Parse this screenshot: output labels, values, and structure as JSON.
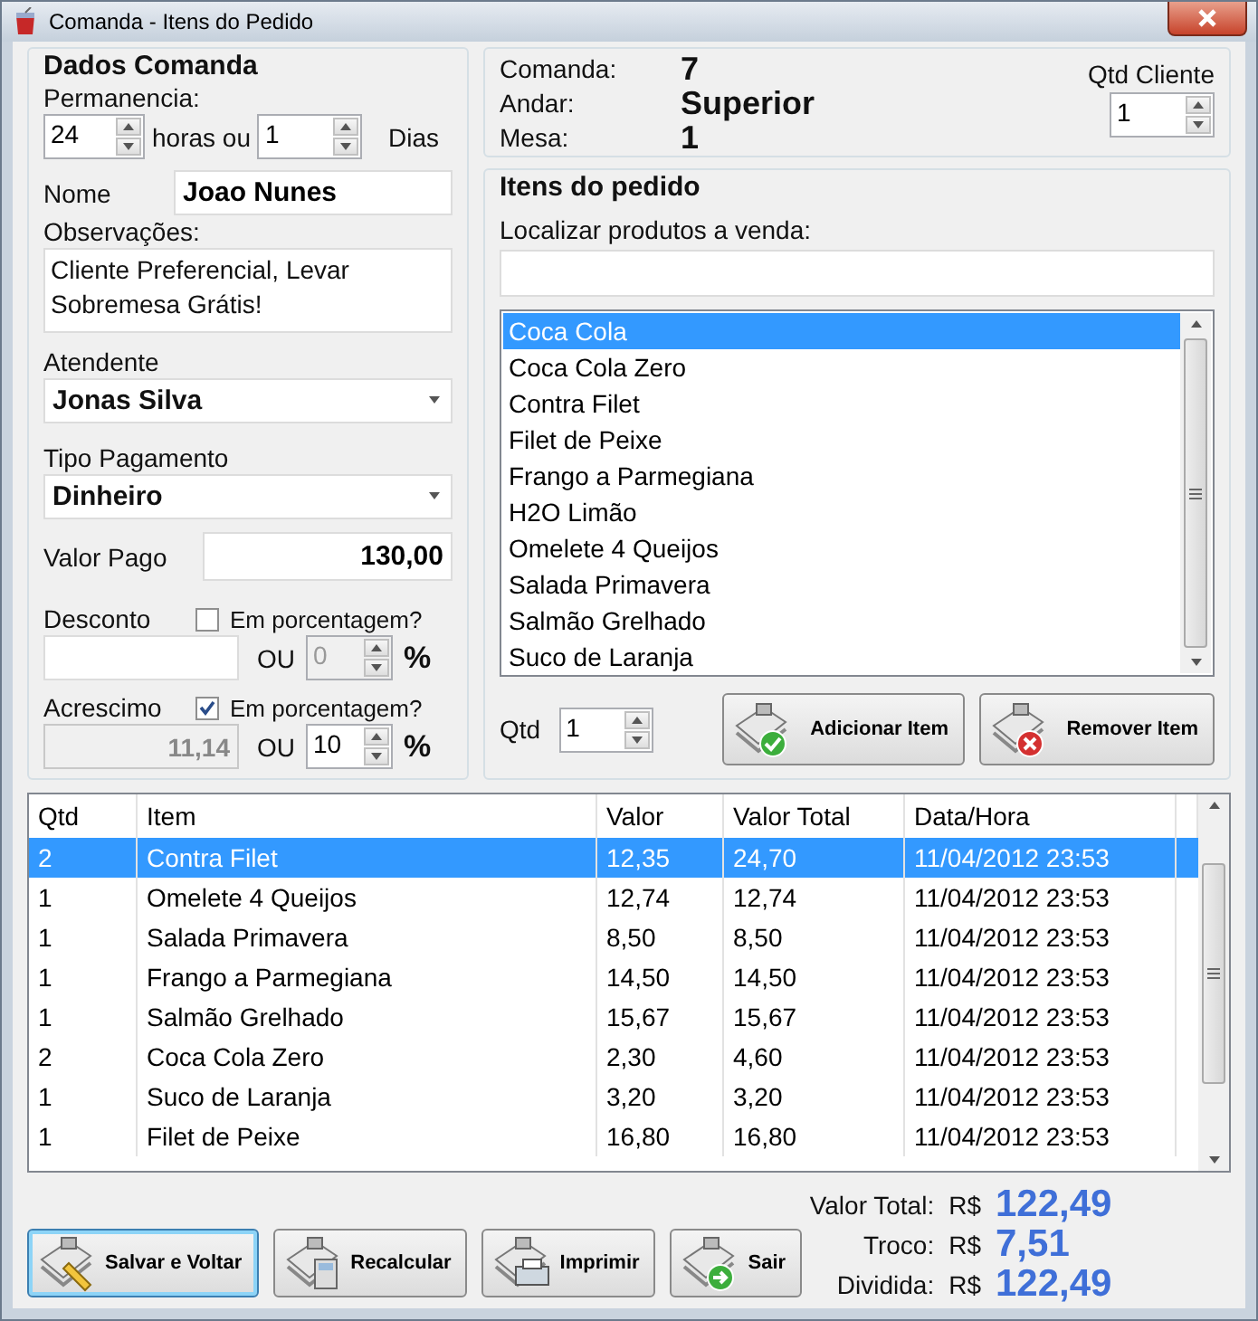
{
  "window": {
    "title": "Comanda - Itens do Pedido"
  },
  "dados": {
    "title": "Dados Comanda",
    "permanencia_label": "Permanencia:",
    "hours": "24",
    "hours_label": "horas ou",
    "days": "1",
    "days_label": "Dias",
    "nome_label": "Nome",
    "nome": "Joao Nunes",
    "obs_label": "Observações:",
    "obs": "Cliente Preferencial, Levar Sobremesa Grátis!",
    "atendente_label": "Atendente",
    "atendente": "Jonas Silva",
    "pagamento_label": "Tipo Pagamento",
    "pagamento": "Dinheiro",
    "valor_pago_label": "Valor Pago",
    "valor_pago": "130,00",
    "adjustments": [
      {
        "label": "Desconto",
        "check_label": "Em porcentagem?",
        "checked": false,
        "value_disabled": false,
        "or_label": "OU",
        "percent": "0",
        "percent_disabled": true,
        "percent_sign": "%"
      },
      {
        "label": "Acrescimo",
        "check_label": "Em porcentagem?",
        "checked": true,
        "value": "11,14",
        "value_disabled": true,
        "or_label": "OU",
        "percent": "10",
        "percent_disabled": false,
        "percent_sign": "%"
      }
    ]
  },
  "info": {
    "rows": [
      {
        "label": "Comanda:",
        "value": "7"
      },
      {
        "label": "Andar:",
        "value": "Superior"
      },
      {
        "label": "Mesa:",
        "value": "1"
      }
    ],
    "qtd_cliente_label": "Qtd Cliente",
    "qtd_cliente": "1"
  },
  "itens": {
    "title": "Itens do pedido",
    "search_label": "Localizar produtos a venda:",
    "products": [
      {
        "name": "Coca Cola",
        "selected": true
      },
      {
        "name": "Coca Cola Zero",
        "selected": false
      },
      {
        "name": "Contra Filet",
        "selected": false
      },
      {
        "name": "Filet de Peixe",
        "selected": false
      },
      {
        "name": "Frango a Parmegiana",
        "selected": false
      },
      {
        "name": "H2O Limão",
        "selected": false
      },
      {
        "name": "Omelete 4 Queijos",
        "selected": false
      },
      {
        "name": "Salada Primavera",
        "selected": false
      },
      {
        "name": "Salmão Grelhado",
        "selected": false
      },
      {
        "name": "Suco de Laranja",
        "selected": false
      }
    ],
    "qtd_label": "Qtd",
    "qtd": "1",
    "buttons": [
      {
        "label": "Adicionar Item",
        "kind": "add"
      },
      {
        "label": "Remover Item",
        "kind": "remove"
      }
    ]
  },
  "table": {
    "columns": [
      "Qtd",
      "Item",
      "Valor",
      "Valor Total",
      "Data/Hora"
    ],
    "rows": [
      {
        "cells": [
          "2",
          "Contra Filet",
          "12,35",
          "24,70",
          "11/04/2012 23:53"
        ],
        "selected": true
      },
      {
        "cells": [
          "1",
          "Omelete 4 Queijos",
          "12,74",
          "12,74",
          "11/04/2012 23:53"
        ],
        "selected": false
      },
      {
        "cells": [
          "1",
          "Salada Primavera",
          "8,50",
          "8,50",
          "11/04/2012 23:53"
        ],
        "selected": false
      },
      {
        "cells": [
          "1",
          "Frango a Parmegiana",
          "14,50",
          "14,50",
          "11/04/2012 23:53"
        ],
        "selected": false
      },
      {
        "cells": [
          "1",
          "Salmão Grelhado",
          "15,67",
          "15,67",
          "11/04/2012 23:53"
        ],
        "selected": false
      },
      {
        "cells": [
          "2",
          "Coca Cola Zero",
          "2,30",
          "4,60",
          "11/04/2012 23:53"
        ],
        "selected": false
      },
      {
        "cells": [
          "1",
          "Suco de Laranja",
          "3,20",
          "3,20",
          "11/04/2012 23:53"
        ],
        "selected": false
      },
      {
        "cells": [
          "1",
          "Filet de Peixe",
          "16,80",
          "16,80",
          "11/04/2012 23:53"
        ],
        "selected": false
      }
    ]
  },
  "actions": [
    {
      "label": "Salvar e Voltar",
      "kind": "save",
      "focused": true
    },
    {
      "label": "Recalcular",
      "kind": "calc",
      "focused": false
    },
    {
      "label": "Imprimir",
      "kind": "print",
      "focused": false
    },
    {
      "label": "Sair",
      "kind": "exit",
      "focused": false
    }
  ],
  "totals": [
    {
      "label": "Valor Total:",
      "currency": "R$",
      "value": "122,49"
    },
    {
      "label": "Troco:",
      "currency": "R$",
      "value": "7,51"
    },
    {
      "label": "Dividida:",
      "currency": "R$",
      "value": "122,49"
    }
  ]
}
